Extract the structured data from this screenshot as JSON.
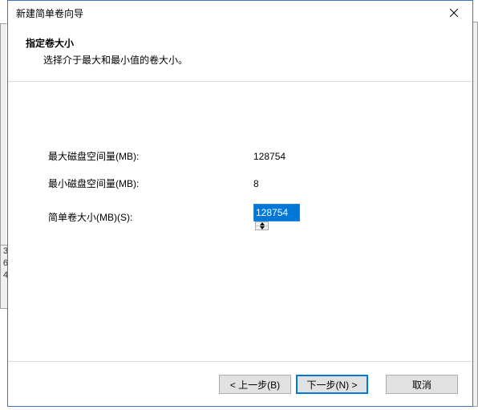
{
  "window": {
    "title": "新建简单卷向导"
  },
  "header": {
    "heading": "指定卷大小",
    "sub": "选择介于最大和最小值的卷大小。"
  },
  "fields": {
    "max": {
      "label": "最大磁盘空间量(MB):",
      "value": "128754"
    },
    "min": {
      "label": "最小磁盘空间量(MB):",
      "value": "8"
    },
    "size": {
      "label": "简单卷大小(MB)(S):",
      "value": "128754"
    }
  },
  "buttons": {
    "back": "< 上一步(B)",
    "next": "下一步(N) >",
    "cancel": "取消"
  },
  "bgtext": "3\n6\n4"
}
